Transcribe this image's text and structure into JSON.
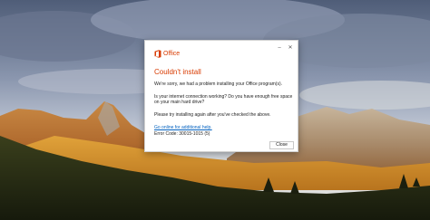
{
  "dialog": {
    "brand": "Office",
    "minimize_glyph": "–",
    "close_glyph": "✕",
    "heading": "Couldn't install",
    "message": "We're sorry, we had a problem installing your Office program(s).",
    "question": "Is your internet connection working?  Do you have enough free space on your main hard drive?",
    "instruction": "Please try installing again after you've checked the above.",
    "help_link": "Go online for additional help.",
    "error_code": "Error Code: 30015-1015 (5)",
    "close_button": "Close"
  },
  "colors": {
    "accent": "#d83b01",
    "link": "#0563c1"
  },
  "icons": {
    "brand_icon": "office-logo-icon"
  }
}
